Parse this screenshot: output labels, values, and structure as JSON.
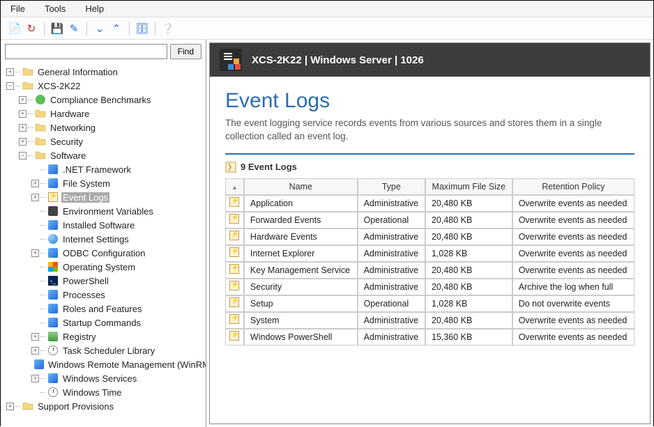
{
  "menu": {
    "file": "File",
    "tools": "Tools",
    "help": "Help"
  },
  "search": {
    "placeholder": "",
    "button": "Find"
  },
  "header": {
    "title": "XCS-2K22 | Windows Server | 1026"
  },
  "page": {
    "heading": "Event Logs",
    "description": "The event logging service records events from various sources and stores them in a single collection called an event log.",
    "section_label": "9 Event Logs"
  },
  "table": {
    "cols": {
      "name": "Name",
      "type": "Type",
      "max": "Maximum File Size",
      "ret": "Retention Policy"
    },
    "rows": [
      {
        "name": "Application",
        "type": "Administrative",
        "max": "20,480 KB",
        "ret": "Overwrite events as needed"
      },
      {
        "name": "Forwarded Events",
        "type": "Operational",
        "max": "20,480 KB",
        "ret": "Overwrite events as needed"
      },
      {
        "name": "Hardware Events",
        "type": "Administrative",
        "max": "20,480 KB",
        "ret": "Overwrite events as needed"
      },
      {
        "name": "Internet Explorer",
        "type": "Administrative",
        "max": "1,028 KB",
        "ret": "Overwrite events as needed"
      },
      {
        "name": "Key Management Service",
        "type": "Administrative",
        "max": "20,480 KB",
        "ret": "Overwrite events as needed"
      },
      {
        "name": "Security",
        "type": "Administrative",
        "max": "20,480 KB",
        "ret": "Archive the log when full"
      },
      {
        "name": "Setup",
        "type": "Operational",
        "max": "1,028 KB",
        "ret": "Do not overwrite events"
      },
      {
        "name": "System",
        "type": "Administrative",
        "max": "20,480 KB",
        "ret": "Overwrite events as needed"
      },
      {
        "name": "Windows PowerShell",
        "type": "Administrative",
        "max": "15,360 KB",
        "ret": "Overwrite events as needed"
      }
    ]
  },
  "tree": [
    {
      "d": 0,
      "t": "+",
      "icon": "folder",
      "label": "General Information"
    },
    {
      "d": 0,
      "t": "-",
      "icon": "folder",
      "label": "XCS-2K22"
    },
    {
      "d": 1,
      "t": "+",
      "icon": "green",
      "label": "Compliance Benchmarks"
    },
    {
      "d": 1,
      "t": "+",
      "icon": "folder",
      "label": "Hardware"
    },
    {
      "d": 1,
      "t": "+",
      "icon": "folder",
      "label": "Networking"
    },
    {
      "d": 1,
      "t": "+",
      "icon": "folder",
      "label": "Security"
    },
    {
      "d": 1,
      "t": "-",
      "icon": "folder-open",
      "label": "Software"
    },
    {
      "d": 2,
      "t": " ",
      "icon": "generic",
      "label": ".NET Framework"
    },
    {
      "d": 2,
      "t": "+",
      "icon": "generic",
      "label": "File System"
    },
    {
      "d": 2,
      "t": "+",
      "icon": "orange",
      "label": "Event Logs",
      "selected": true
    },
    {
      "d": 2,
      "t": " ",
      "icon": "dark",
      "label": "Environment Variables"
    },
    {
      "d": 2,
      "t": " ",
      "icon": "generic",
      "label": "Installed Software"
    },
    {
      "d": 2,
      "t": " ",
      "icon": "globe",
      "label": "Internet Settings"
    },
    {
      "d": 2,
      "t": "+",
      "icon": "generic",
      "label": "ODBC Configuration"
    },
    {
      "d": 2,
      "t": " ",
      "icon": "win",
      "label": "Operating System"
    },
    {
      "d": 2,
      "t": " ",
      "icon": "ps",
      "label": "PowerShell"
    },
    {
      "d": 2,
      "t": " ",
      "icon": "generic",
      "label": "Processes"
    },
    {
      "d": 2,
      "t": " ",
      "icon": "generic",
      "label": "Roles and Features"
    },
    {
      "d": 2,
      "t": " ",
      "icon": "generic",
      "label": "Startup Commands"
    },
    {
      "d": 2,
      "t": "+",
      "icon": "reg",
      "label": "Registry"
    },
    {
      "d": 2,
      "t": "+",
      "icon": "clock",
      "label": "Task Scheduler Library"
    },
    {
      "d": 2,
      "t": " ",
      "icon": "generic",
      "label": "Windows Remote Management (WinRM)"
    },
    {
      "d": 2,
      "t": "+",
      "icon": "generic",
      "label": "Windows Services"
    },
    {
      "d": 2,
      "t": " ",
      "icon": "clock",
      "label": "Windows Time"
    },
    {
      "d": 0,
      "t": "+",
      "icon": "folder",
      "label": "Support Provisions"
    }
  ]
}
